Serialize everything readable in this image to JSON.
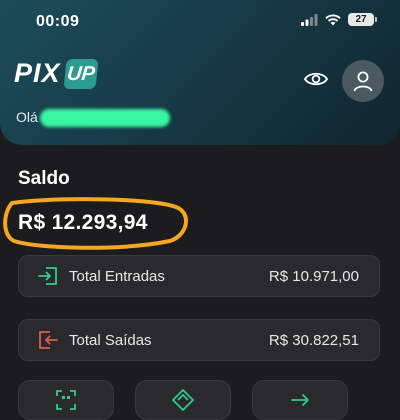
{
  "status_bar": {
    "time": "00:09",
    "battery": "27"
  },
  "header": {
    "logo_text": "PIX",
    "logo_badge": "UP",
    "greeting": "Olá"
  },
  "balance": {
    "label": "Saldo",
    "value": "R$ 12.293,94"
  },
  "summary": [
    {
      "label": "Total Entradas",
      "amount": "R$ 10.971,00",
      "icon": "arrow-in-icon",
      "color": "#2ecc8f"
    },
    {
      "label": "Total Saídas",
      "amount": "R$ 30.822,51",
      "icon": "arrow-out-icon",
      "color": "#e05a4f"
    }
  ],
  "actions": [
    {
      "icon": "qr-scan-icon"
    },
    {
      "icon": "pix-icon"
    },
    {
      "icon": "arrow-right-icon"
    }
  ],
  "colors": {
    "accent": "#2ecc8f",
    "highlight": "#f5a623",
    "header": "#173b48"
  }
}
